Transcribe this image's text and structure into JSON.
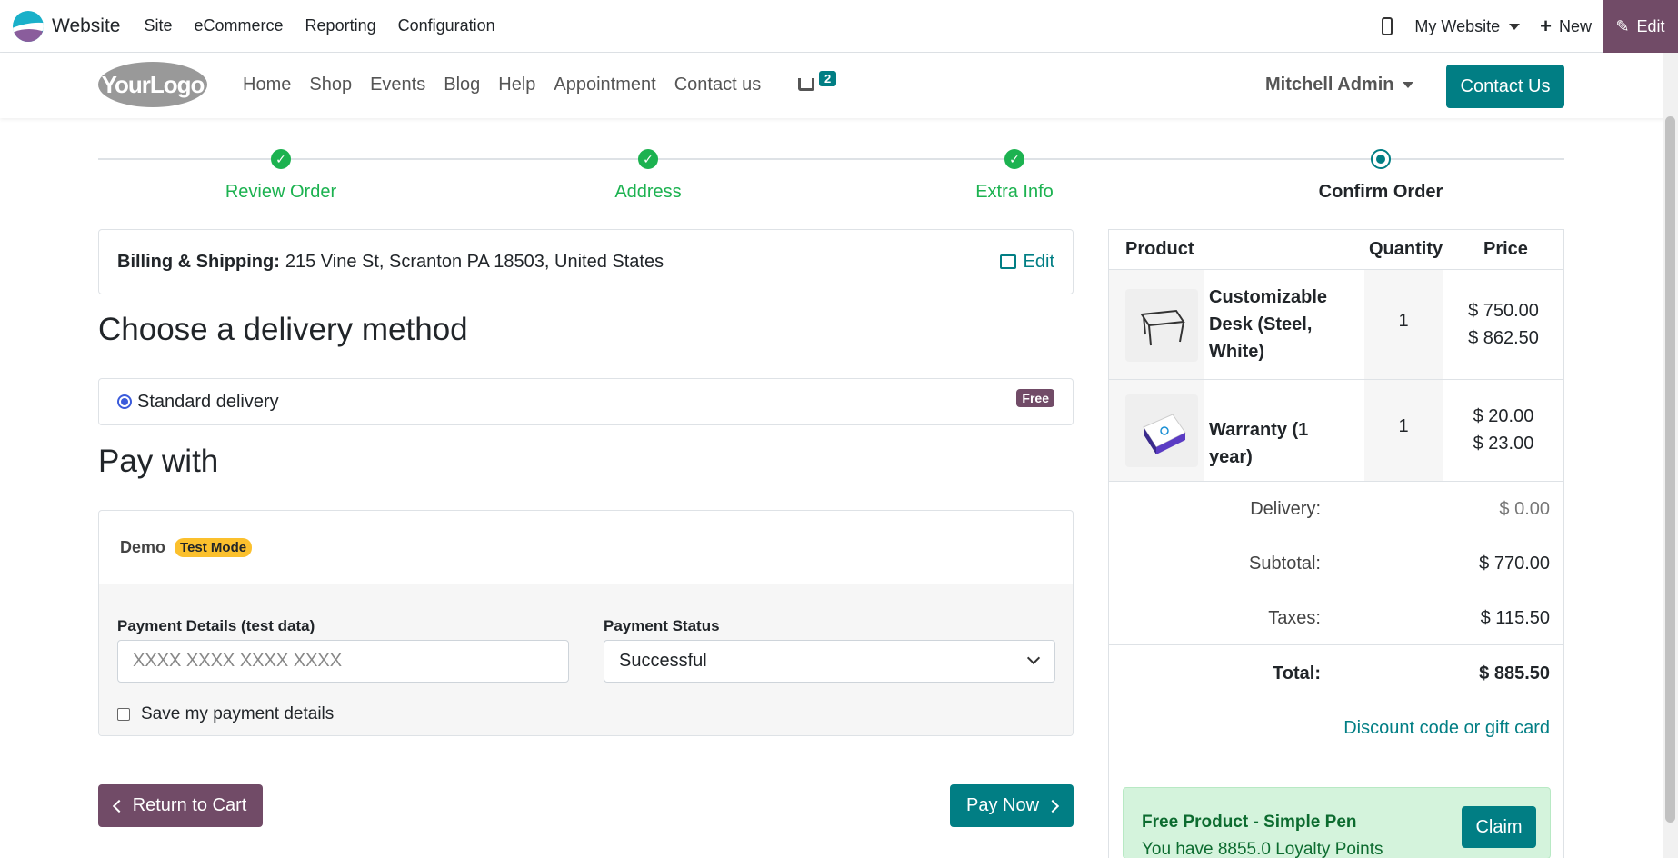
{
  "admin": {
    "app_name": "Website",
    "menu": [
      "Site",
      "eCommerce",
      "Reporting",
      "Configuration"
    ],
    "website_selector": "My Website",
    "new_label": "New",
    "edit_label": "Edit"
  },
  "header": {
    "logo_text": "YourLogo",
    "nav": [
      "Home",
      "Shop",
      "Events",
      "Blog",
      "Help",
      "Appointment",
      "Contact us"
    ],
    "cart_count": "2",
    "user": "Mitchell Admin",
    "contact_button": "Contact Us"
  },
  "steps": [
    {
      "label": "Review Order",
      "state": "done"
    },
    {
      "label": "Address",
      "state": "done"
    },
    {
      "label": "Extra Info",
      "state": "done"
    },
    {
      "label": "Confirm Order",
      "state": "current"
    }
  ],
  "billing": {
    "label": "Billing & Shipping:",
    "address": "215 Vine St, Scranton PA 18503, United States",
    "edit_label": "Edit"
  },
  "delivery": {
    "heading": "Choose a delivery method",
    "option": "Standard delivery",
    "badge": "Free"
  },
  "payment": {
    "heading": "Pay with",
    "provider": "Demo",
    "mode_badge": "Test Mode",
    "details_label": "Payment Details (test data)",
    "details_placeholder": "XXXX XXXX XXXX XXXX",
    "status_label": "Payment Status",
    "status_value": "Successful",
    "save_label": "Save my payment details"
  },
  "buttons": {
    "return": "Return to Cart",
    "pay": "Pay Now"
  },
  "summary": {
    "headers": {
      "product": "Product",
      "quantity": "Quantity",
      "price": "Price"
    },
    "items": [
      {
        "name": "Customizable Desk (Steel, White)",
        "qty": "1",
        "price": "$ 750.00",
        "price_tax": "$ 862.50"
      },
      {
        "name": "Warranty (1 year)",
        "qty": "1",
        "price": "$ 20.00",
        "price_tax": "$ 23.00"
      }
    ],
    "delivery_label": "Delivery:",
    "delivery_value": "$ 0.00",
    "subtotal_label": "Subtotal:",
    "subtotal_value": "$ 770.00",
    "taxes_label": "Taxes:",
    "taxes_value": "$ 115.50",
    "total_label": "Total:",
    "total_value": "$ 885.50",
    "discount_link": "Discount code or gift card",
    "promo_title": "Free Product - Simple Pen",
    "promo_text": "You have 8855.0 Loyalty Points",
    "claim_label": "Claim"
  },
  "colors": {
    "brand_purple": "#714b67",
    "teal": "#017e84",
    "step_green": "#1cb250"
  }
}
